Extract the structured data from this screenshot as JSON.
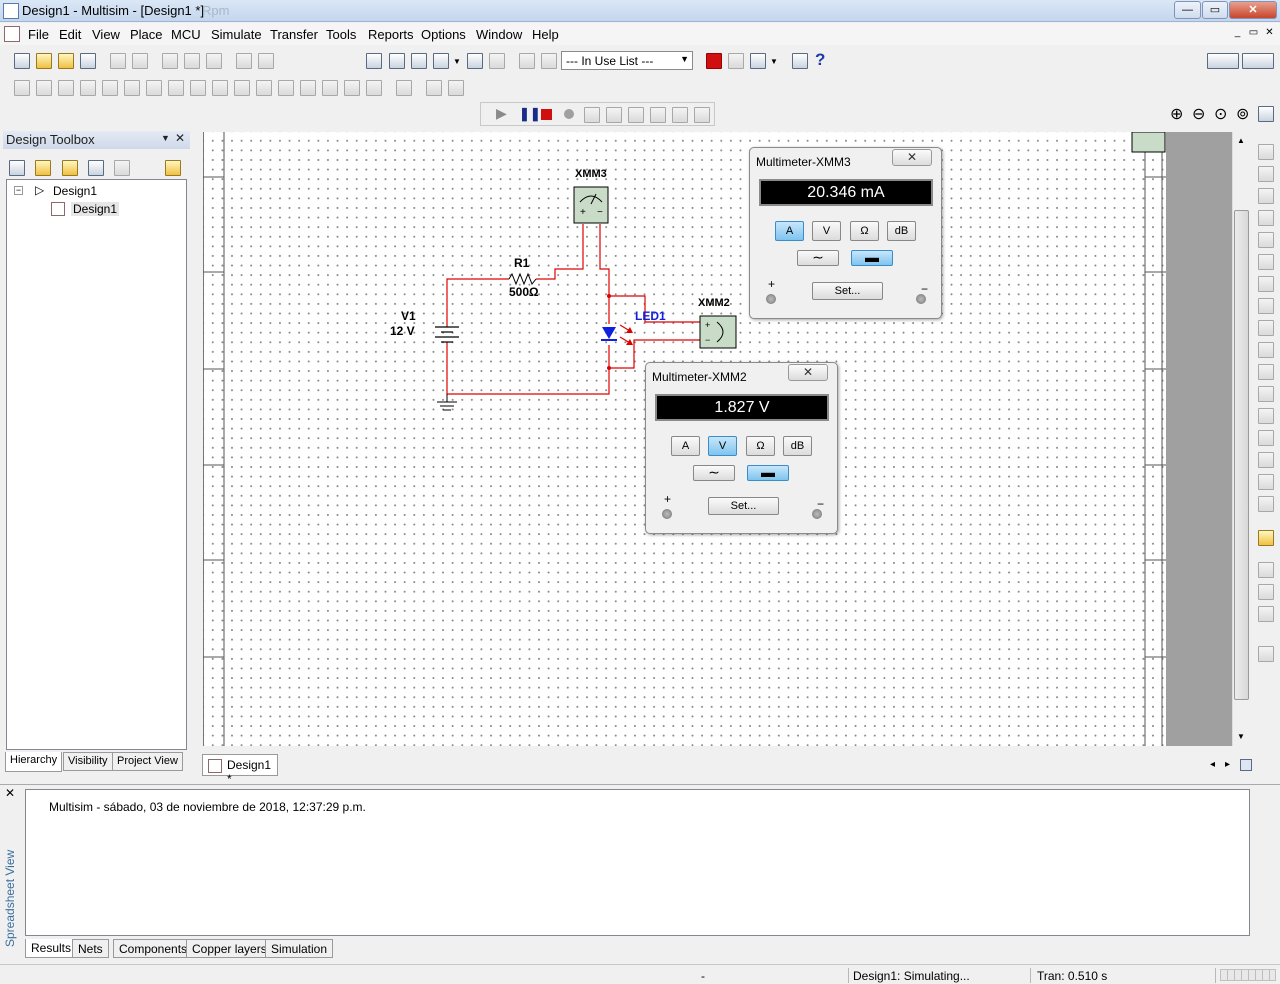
{
  "window": {
    "title": "Design1 - Multisim - [Design1 *]",
    "faded_title": "Rpm",
    "controls": {
      "minimize": "—",
      "maximize": "▭",
      "close": "✕"
    }
  },
  "menu": [
    "File",
    "Edit",
    "View",
    "Place",
    "MCU",
    "Simulate",
    "Transfer",
    "Tools",
    "Reports",
    "Options",
    "Window",
    "Help"
  ],
  "toolbar": {
    "in_use_list": "--- In Use List ---"
  },
  "design_toolbox": {
    "title": "Design Toolbox",
    "tree": [
      {
        "label": "Design1"
      },
      {
        "label": "Design1"
      }
    ],
    "tabs": [
      "Hierarchy",
      "Visibility",
      "Project View"
    ]
  },
  "schematic": {
    "v1_name": "V1",
    "v1_value": "12 V",
    "r1_name": "R1",
    "r1_value": "500Ω",
    "led_name": "LED1",
    "xmm3_name": "XMM3",
    "xmm2_name": "XMM2",
    "wire_color": "#e00000",
    "led_color": "#1020e0"
  },
  "multimeters": [
    {
      "title": "Multimeter-XMM3",
      "reading": "20.346 mA",
      "modes": [
        "A",
        "V",
        "Ω",
        "dB"
      ],
      "active_mode": "A",
      "active_wave": "dc",
      "set_label": "Set...",
      "plus": "+",
      "minus": "−"
    },
    {
      "title": "Multimeter-XMM2",
      "reading": "1.827 V",
      "modes": [
        "A",
        "V",
        "Ω",
        "dB"
      ],
      "active_mode": "V",
      "active_wave": "dc",
      "set_label": "Set...",
      "plus": "+",
      "minus": "−"
    }
  ],
  "sheet_tab": "Design1 *",
  "spreadsheet": {
    "vertical_label": "Spreadsheet View",
    "message": "Multisim  -  sábado, 03 de noviembre de 2018, 12:37:29 p.m.",
    "tabs": [
      "Results",
      "Nets",
      "Components",
      "Copper layers",
      "Simulation"
    ]
  },
  "status": {
    "dash": "-",
    "design": "Design1: Simulating...",
    "tran": "Tran: 0.510 s"
  },
  "colors": {
    "accent": "#3a8ec8",
    "display_bg": "#000000",
    "wire": "#e00000"
  }
}
